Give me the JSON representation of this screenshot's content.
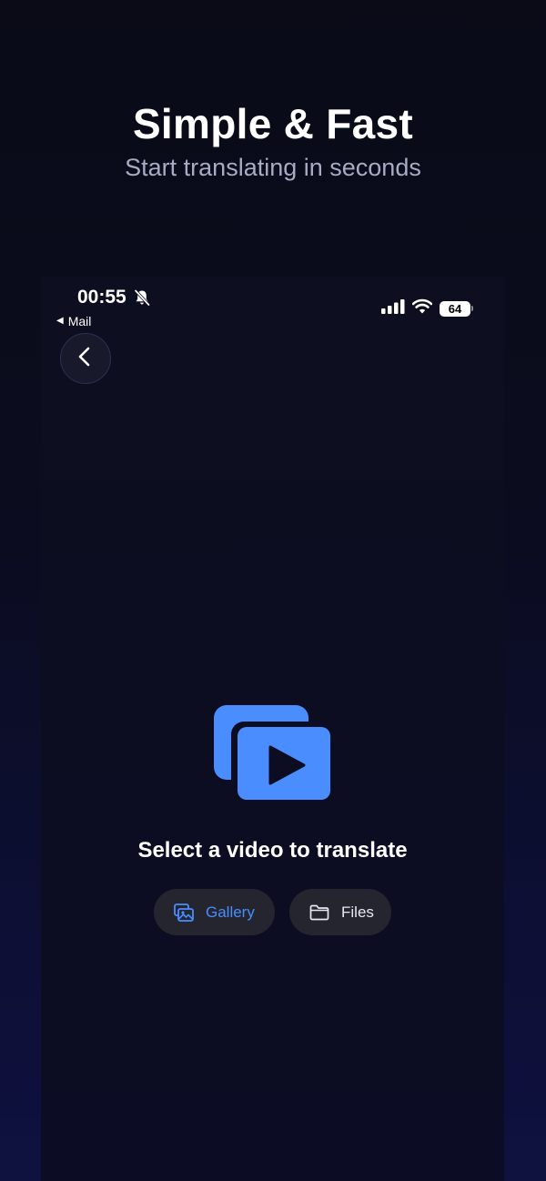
{
  "promo": {
    "title": "Simple & Fast",
    "subtitle": "Start translating in seconds"
  },
  "status_bar": {
    "time": "00:55",
    "back_app": "Mail",
    "battery": "64"
  },
  "main": {
    "prompt": "Select a video to translate",
    "gallery_label": "Gallery",
    "files_label": "Files"
  },
  "colors": {
    "accent": "#4a8dff",
    "background": "#0c0d21",
    "button_bg": "#24252f"
  },
  "icons": [
    "bell-slash-icon",
    "signal-icon",
    "wifi-icon",
    "battery-icon",
    "chevron-left-icon",
    "video-stack-icon",
    "gallery-icon",
    "folder-icon"
  ]
}
